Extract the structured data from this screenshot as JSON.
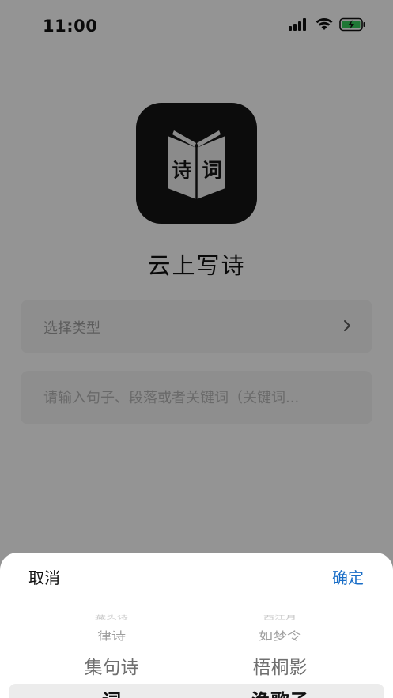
{
  "status_bar": {
    "time": "11:00"
  },
  "app": {
    "logo_chars": [
      "诗",
      "词"
    ],
    "title": "云上写诗"
  },
  "form": {
    "type_selector_label": "选择类型",
    "input_placeholder": "请输入句子、段落或者关键词（关键词..."
  },
  "picker_sheet": {
    "cancel_label": "取消",
    "confirm_label": "确定",
    "left_column": [
      "藏头诗",
      "律诗",
      "集句诗",
      "词"
    ],
    "right_column": [
      "西江月",
      "如梦令",
      "梧桐影",
      "渔歌子"
    ]
  },
  "colors": {
    "accent": "#1a6ec7",
    "overlay": "rgba(0,0,0,0.40)"
  }
}
